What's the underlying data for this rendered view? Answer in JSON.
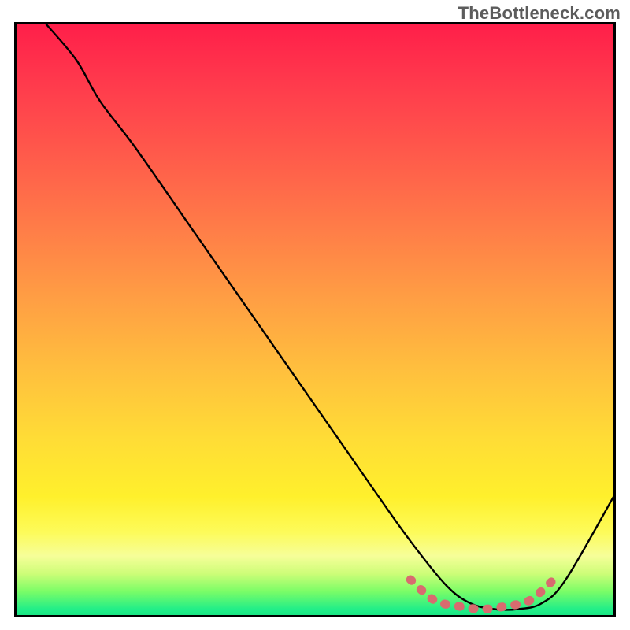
{
  "watermark": "TheBottleneck.com",
  "chart_data": {
    "type": "line",
    "title": "",
    "xlabel": "",
    "ylabel": "",
    "xlim": [
      0,
      100
    ],
    "ylim": [
      0,
      100
    ],
    "series": [
      {
        "name": "bottleneck-curve",
        "x": [
          5,
          10,
          14,
          20,
          30,
          40,
          50,
          60,
          66,
          72,
          76,
          80,
          84,
          88,
          92,
          100
        ],
        "y": [
          100,
          94,
          87,
          79,
          64.5,
          50,
          35.5,
          21,
          12.5,
          5,
          2,
          1,
          1,
          2,
          6,
          20
        ],
        "color": "#000000"
      },
      {
        "name": "bottleneck-range-marker",
        "x": [
          66,
          70,
          74,
          78,
          82,
          86,
          90
        ],
        "y": [
          6,
          2.5,
          1.5,
          1,
          1.5,
          2.5,
          6
        ],
        "color": "#d86b6f"
      }
    ],
    "background_gradient": {
      "top_color": "#ff1f4a",
      "mid_color": "#ffdc36",
      "bottom_color": "#22ee88"
    }
  }
}
